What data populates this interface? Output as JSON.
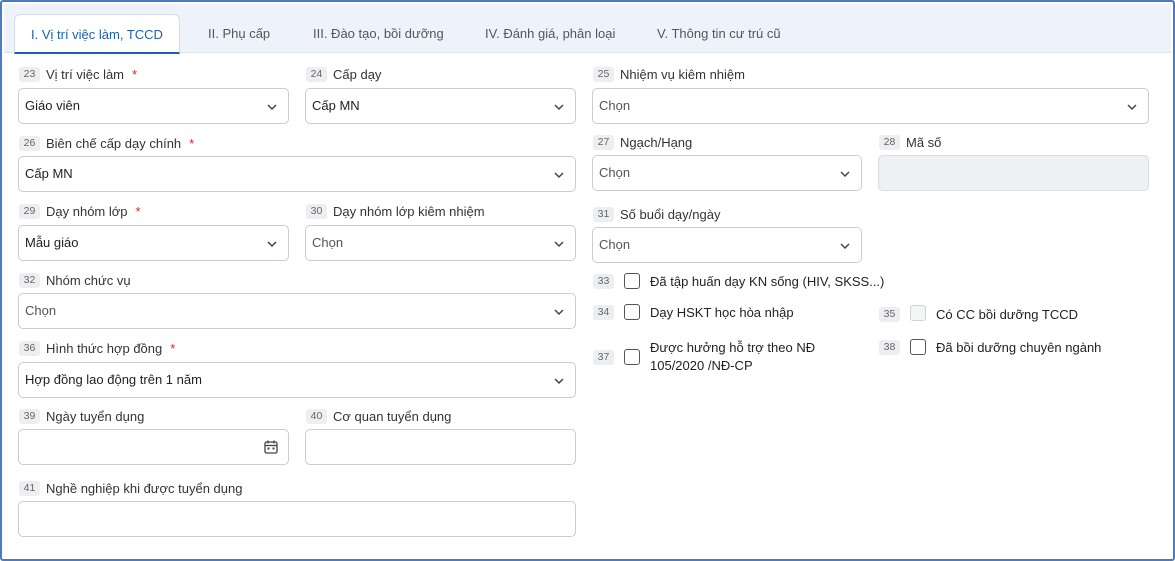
{
  "tabs": [
    {
      "label": "I. Vị trí việc làm, TCCD",
      "active": true
    },
    {
      "label": "II. Phụ cấp",
      "active": false
    },
    {
      "label": "III. Đào tạo, bồi dưỡng",
      "active": false
    },
    {
      "label": "IV. Đánh giá, phân loại",
      "active": false
    },
    {
      "label": "V. Thông tin cư trú cũ",
      "active": false
    }
  ],
  "fields": {
    "f23": {
      "num": "23",
      "label": "Vị trí việc làm",
      "required": "*",
      "value": "Giáo viên"
    },
    "f24": {
      "num": "24",
      "label": "Cấp dạy",
      "value": "Cấp MN"
    },
    "f25": {
      "num": "25",
      "label": "Nhiệm vụ kiêm nhiệm",
      "value": "Chọn"
    },
    "f26": {
      "num": "26",
      "label": "Biên chế cấp dạy chính",
      "required": "*",
      "value": "Cấp MN"
    },
    "f27": {
      "num": "27",
      "label": "Ngạch/Hạng",
      "value": "Chọn"
    },
    "f28": {
      "num": "28",
      "label": "Mã số",
      "value": ""
    },
    "f29": {
      "num": "29",
      "label": "Dạy nhóm lớp",
      "required": "*",
      "value": "Mẫu giáo"
    },
    "f30": {
      "num": "30",
      "label": "Dạy nhóm lớp kiêm nhiệm",
      "value": "Chọn"
    },
    "f31": {
      "num": "31",
      "label": "Số buổi dạy/ngày",
      "value": "Chọn"
    },
    "f32": {
      "num": "32",
      "label": "Nhóm chức vụ",
      "value": "Chọn"
    },
    "f36": {
      "num": "36",
      "label": "Hình thức hợp đồng",
      "required": "*",
      "value": "Hợp đồng lao động trên 1 năm"
    },
    "f39": {
      "num": "39",
      "label": "Ngày tuyển dụng",
      "value": ""
    },
    "f40": {
      "num": "40",
      "label": "Cơ quan tuyển dụng",
      "value": ""
    },
    "f41": {
      "num": "41",
      "label": "Nghề nghiệp khi được tuyển dụng",
      "value": ""
    }
  },
  "checkboxes": {
    "c33": {
      "num": "33",
      "label": "Đã tập huấn dạy KN sống (HIV, SKSS...)",
      "checked": false
    },
    "c34": {
      "num": "34",
      "label": "Dạy HSKT học hòa nhập",
      "checked": false
    },
    "c35": {
      "num": "35",
      "label": "Có CC bồi dưỡng TCCD",
      "checked": false,
      "disabled": true
    },
    "c37": {
      "num": "37",
      "label_line1": "Được hưởng hỗ trợ theo NĐ",
      "label_line2": "105/2020 /NĐ-CP",
      "checked": false
    },
    "c38": {
      "num": "38",
      "label": "Đã bồi dưỡng chuyên ngành",
      "checked": false
    }
  },
  "icons": {
    "dropdown": "chevron-down-icon",
    "date": "calendar-icon"
  },
  "colors": {
    "accent": "#1a5fb4",
    "required": "#e02424",
    "frame": "#4a7cc4"
  }
}
